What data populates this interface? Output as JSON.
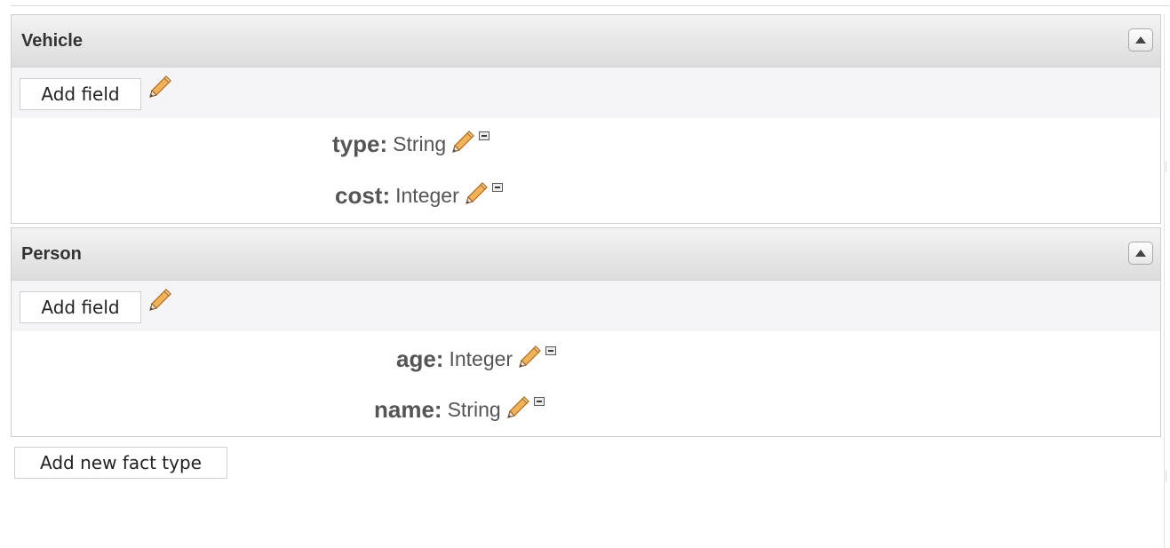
{
  "fact_types": [
    {
      "name": "Vehicle",
      "add_field_label": "Add field",
      "fields": [
        {
          "name": "type:",
          "type": "String"
        },
        {
          "name": "cost:",
          "type": "Integer"
        }
      ]
    },
    {
      "name": "Person",
      "add_field_label": "Add field",
      "fields": [
        {
          "name": "age:",
          "type": "Integer"
        },
        {
          "name": "name:",
          "type": "String"
        }
      ]
    }
  ],
  "footer": {
    "add_fact_type_label": "Add new fact type"
  },
  "icons": {
    "pencil": "pencil-icon",
    "remove": "remove-field-icon",
    "collapse": "collapse-up-icon"
  }
}
